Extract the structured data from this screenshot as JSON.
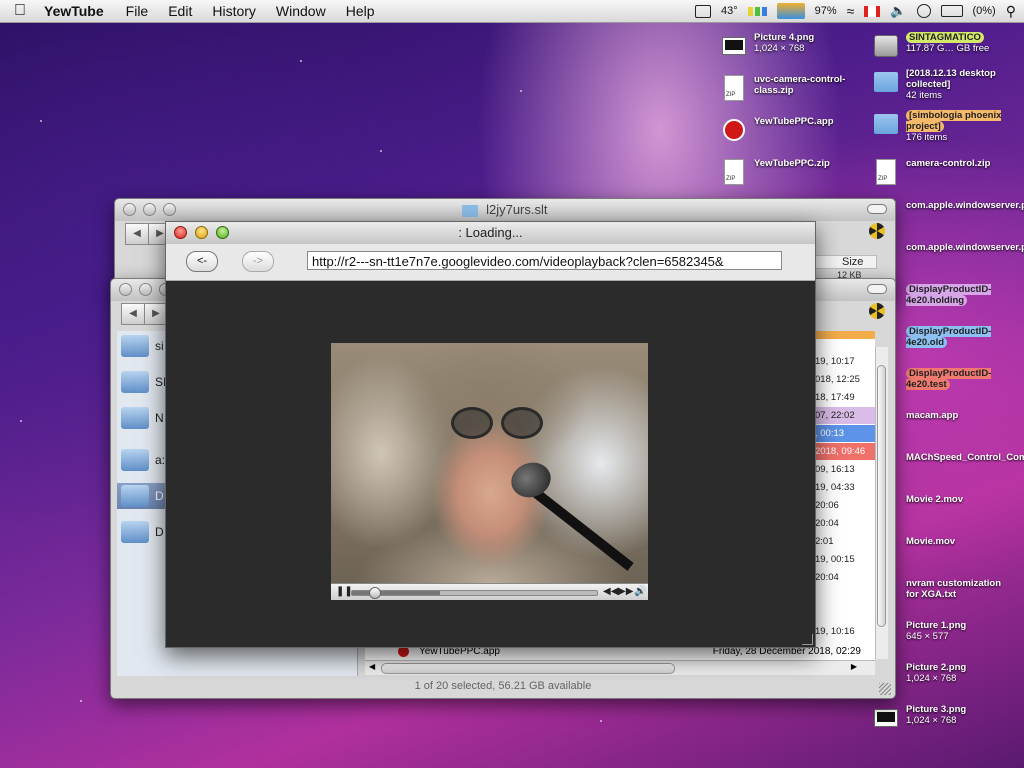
{
  "menubar": {
    "app_name": "YewTube",
    "items": [
      "File",
      "Edit",
      "History",
      "Window",
      "Help"
    ],
    "temperature": "43°",
    "wifi_percent": "97%",
    "battery": "(0%)"
  },
  "desktop_icons": [
    {
      "name": "Picture 4.png",
      "sub": "1,024 × 768",
      "type": "screen"
    },
    {
      "name": "SINTAGMATICO",
      "sub": "117.87 G… GB free",
      "type": "drive",
      "tag_color": "#d4e86a"
    },
    {
      "name": "uvc-camera-control-class.zip",
      "sub": "",
      "type": "zip"
    },
    {
      "name": "[2018.12.13 desktop collected]",
      "sub": "42 items",
      "type": "folder"
    },
    {
      "name": "YewTubePPC.app",
      "sub": "",
      "type": "app"
    },
    {
      "name": "[simbologia phoenix project]",
      "sub": "176 items",
      "type": "folder",
      "tag_color": "#f5b96a"
    },
    {
      "name": "YewTubePPC.zip",
      "sub": "",
      "type": "zip"
    },
    {
      "name": "camera-control.zip",
      "sub": "",
      "type": "zip"
    },
    {
      "name": "com.apple.windowserver.plist",
      "sub": "",
      "type": "file"
    },
    {
      "name": "com.apple.windowserver.plist.orig",
      "sub": "",
      "type": "file"
    },
    {
      "name": "DisplayProductID-4e20.holding",
      "sub": "",
      "type": "file",
      "tag_color": "#d6a6e8"
    },
    {
      "name": "DisplayProductID-4e20.old",
      "sub": "",
      "type": "file",
      "tag_color": "#8cc0f0"
    },
    {
      "name": "DisplayProductID-4e20.test",
      "sub": "",
      "type": "file",
      "tag_color": "#f07a70"
    },
    {
      "name": "macam.app",
      "sub": "",
      "type": "file"
    },
    {
      "name": "MAChSpeed_Control_Combo.dmg",
      "sub": "",
      "type": "file"
    },
    {
      "name": "Movie 2.mov",
      "sub": "",
      "type": "file"
    },
    {
      "name": "Movie.mov",
      "sub": "",
      "type": "file"
    },
    {
      "name": "nvram customization for XGA.txt",
      "sub": "",
      "type": "file"
    },
    {
      "name": "Picture 1.png",
      "sub": "645 × 577",
      "type": "file"
    },
    {
      "name": "Picture 2.png",
      "sub": "1,024 × 768",
      "type": "file"
    },
    {
      "name": "Picture 3.png",
      "sub": "1,024 × 768",
      "type": "screen"
    }
  ],
  "finder_back": {
    "title": "l2jy7urs.slt",
    "column_size": "Size",
    "size_value": "12 KB"
  },
  "finder_front": {
    "sidebar": [
      {
        "label": "si",
        "icon": "monitor-icon"
      },
      {
        "label": "SI",
        "icon": "drive-icon"
      },
      {
        "label": "N",
        "icon": "network-icon"
      },
      {
        "label": "a:",
        "icon": "home-icon"
      },
      {
        "label": "D",
        "icon": "desktop-icon",
        "selected": true
      },
      {
        "label": "D",
        "icon": "folder-icon"
      }
    ],
    "dates": [
      {
        "text": "19, 10:17",
        "color": ""
      },
      {
        "text": "018, 12:25",
        "color": ""
      },
      {
        "text": "18, 17:49",
        "color": ""
      },
      {
        "text": "07, 22:02",
        "color": "purple"
      },
      {
        "text": ", 00:13",
        "color": "blue"
      },
      {
        "text": "2018, 09:46",
        "color": "red"
      },
      {
        "text": "09, 16:13",
        "color": ""
      },
      {
        "text": "19, 04:33",
        "color": ""
      },
      {
        "text": "20:06",
        "color": ""
      },
      {
        "text": "20:04",
        "color": ""
      },
      {
        "text": "2:01",
        "color": ""
      },
      {
        "text": "19, 00:15",
        "color": ""
      },
      {
        "text": "20:04",
        "color": ""
      }
    ],
    "last_date": "19, 10:16",
    "bottom_file_name": "YewTubePPC.app",
    "bottom_file_date": "Friday, 28 December 2018, 02:29",
    "status": "1 of 20 selected, 56.21 GB available"
  },
  "yewtube": {
    "title": ":  Loading...",
    "back_label": "<-",
    "forward_label": "->",
    "url": "http://r2---sn-tt1e7n7e.googlevideo.com/videoplayback?clen=6582345&",
    "progress": 0.09,
    "buffered": 0.36
  }
}
